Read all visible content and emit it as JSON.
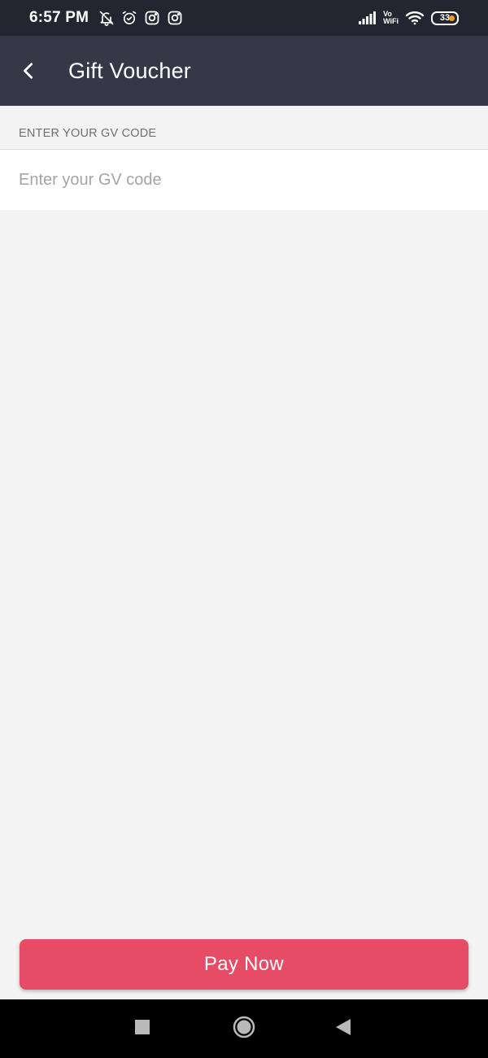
{
  "status_bar": {
    "time": "6:57 PM",
    "left_icons": [
      "bell-off-icon",
      "alarm-icon",
      "instagram-icon",
      "instagram-icon"
    ],
    "network": "VoWiFi",
    "vo_label": "Vo",
    "wifi_label": "WiFi",
    "battery_level": "33"
  },
  "app_bar": {
    "title": "Gift Voucher",
    "back_icon": "chevron-left-icon"
  },
  "gv_section": {
    "label": "ENTER YOUR GV CODE",
    "input_placeholder": "Enter your GV code",
    "input_value": ""
  },
  "actions": {
    "pay_label": "Pay Now"
  },
  "nav_bar": {
    "icons": [
      "recents-icon",
      "home-icon",
      "back-icon"
    ]
  },
  "colors": {
    "status_bar_bg": "#232530",
    "app_bar_bg": "#363847",
    "page_bg": "#f3f3f3",
    "accent": "#e74c66",
    "battery_dot": "#f0a020"
  }
}
